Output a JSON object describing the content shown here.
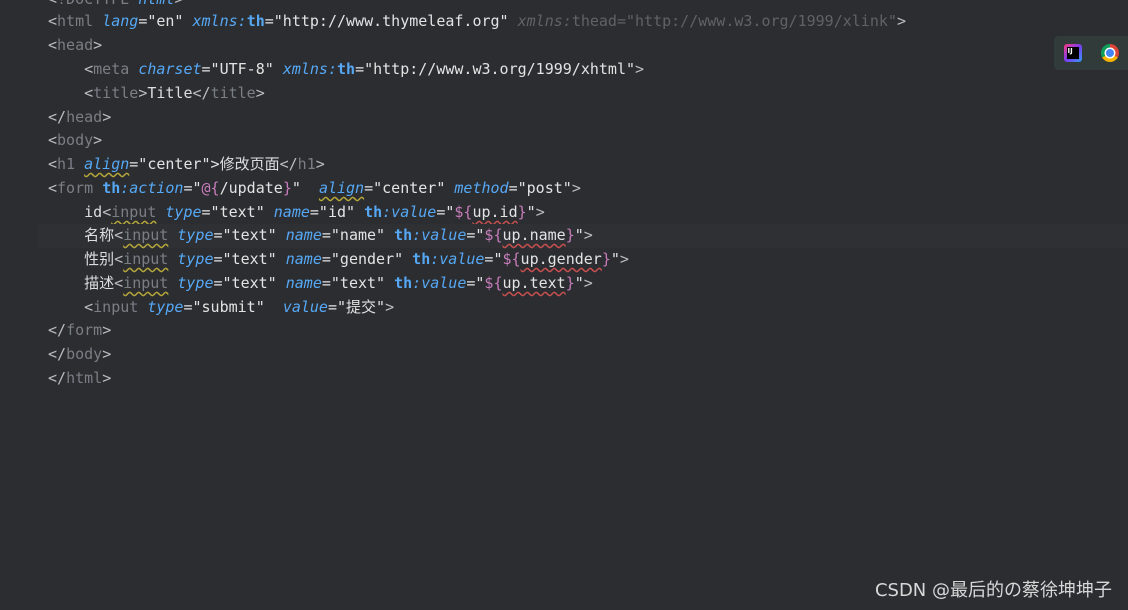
{
  "editor": {
    "line0": {
      "br1": "<",
      "tag": "!DOCTYPE",
      "rest": " html",
      ">": ">"
    },
    "line1": {
      "p1": "<",
      "tag": "html",
      " ": " ",
      "a1": "lang",
      "eq1": "=\"en\" ",
      "a2ns": "xmlns:",
      "a2": "th",
      "eq2": "=\"http://www.thymeleaf.org\" ",
      "dim1": "xmlns:",
      "dim2": "thead",
      "dim3": "=\"http://www.w3.org/1999/xlink\"",
      "p2": ">"
    },
    "line2": {
      "p1": "<",
      "tag": "head",
      "p2": ">"
    },
    "line3": {
      "p1": "<",
      "tag": "meta",
      "a1": "charset",
      "eq1": "=\"UTF-8\" ",
      "a2ns": "xmlns:",
      "a2": "th",
      "eq2": "=\"http://www.w3.org/1999/xhtml\"",
      "p2": ">"
    },
    "line4": {
      "p1": "<",
      "tag": "title",
      "p2": ">",
      "text": "Title",
      "p3": "</",
      "tag2": "title",
      "p4": ">"
    },
    "line5": {
      "p1": "</",
      "tag": "head",
      "p2": ">"
    },
    "line6": {
      "p1": "<",
      "tag": "body",
      "p2": ">"
    },
    "line7": {
      "p1": "<",
      "tag": "h1",
      "a1": "align",
      "eq1": "=\"center\">",
      "text": "修改页面",
      "p3": "</",
      "tag2": "h1",
      "p4": ">"
    },
    "line8": {
      "p1": "<",
      "tag": "form",
      "ns": "th",
      "a1": ":action",
      "eq1": "=\"",
      "expr1": "@{",
      "path": "/update",
      "expr2": "}",
      "eq1b": "\"  ",
      "a2": "align",
      "eq2": "=\"center\" ",
      "a3": "method",
      "eq3": "=\"post\"",
      "p2": ">"
    },
    "line9": {
      "label": "id",
      "p1": "<",
      "tag": "input",
      "a1": "type",
      "eq1": "=\"text\" ",
      "a2": "name",
      "eq2": "=\"id\" ",
      "ns": "th",
      "a3": ":value",
      "eq3": "=\"",
      "e1": "${",
      "v": "up.id",
      "e2": "}",
      "eq3b": "\"",
      "p2": ">"
    },
    "line10": {
      "label": "名称",
      "p1": "<",
      "tag": "input",
      "a1": "type",
      "eq1": "=\"text\" ",
      "a2": "name",
      "eq2": "=\"name\" ",
      "ns": "th",
      "a3": ":value",
      "eq3": "=\"",
      "e1": "${",
      "v": "up.name",
      "e2": "}",
      "eq3b": "\"",
      "p2": ">"
    },
    "line11": {
      "label": "性别",
      "p1": "<",
      "tag": "input",
      "a1": "type",
      "eq1": "=\"text\" ",
      "a2": "name",
      "eq2": "=\"gender\" ",
      "ns": "th",
      "a3": ":value",
      "eq3": "=\"",
      "e1": "${",
      "v": "up.gender",
      "e2": "}",
      "eq3b": "\"",
      "p2": ">"
    },
    "line12": {
      "label": "描述",
      "p1": "<",
      "tag": "input",
      "a1": "type",
      "eq1": "=\"text\" ",
      "a2": "name",
      "eq2": "=\"text\" ",
      "ns": "th",
      "a3": ":value",
      "eq3": "=\"",
      "e1": "${",
      "v": "up.text",
      "e2": "}",
      "eq3b": "\"",
      "p2": ">"
    },
    "line13": {
      "p1": "<",
      "tag": "input",
      "a1": "type",
      "eq1": "=\"submit\"  ",
      "a2": "value",
      "eq2": "=\"提交\"",
      "p2": ">"
    },
    "line14": {
      "p1": "</",
      "tag": "form",
      "p2": ">"
    },
    "line15": {
      "p1": "</",
      "tag": "body",
      "p2": ">"
    },
    "line16": {
      "p1": "</",
      "tag": "html",
      "p2": ">"
    }
  },
  "browser_bar": {
    "icons": [
      "intellij-icon",
      "chrome-icon"
    ]
  },
  "watermark": "CSDN @最后的の蔡徐坤坤子",
  "colors": {
    "background": "#2b2d30",
    "attr": "#56a8f5",
    "tag": "#7a7e85",
    "expr": "#c77dbb"
  }
}
